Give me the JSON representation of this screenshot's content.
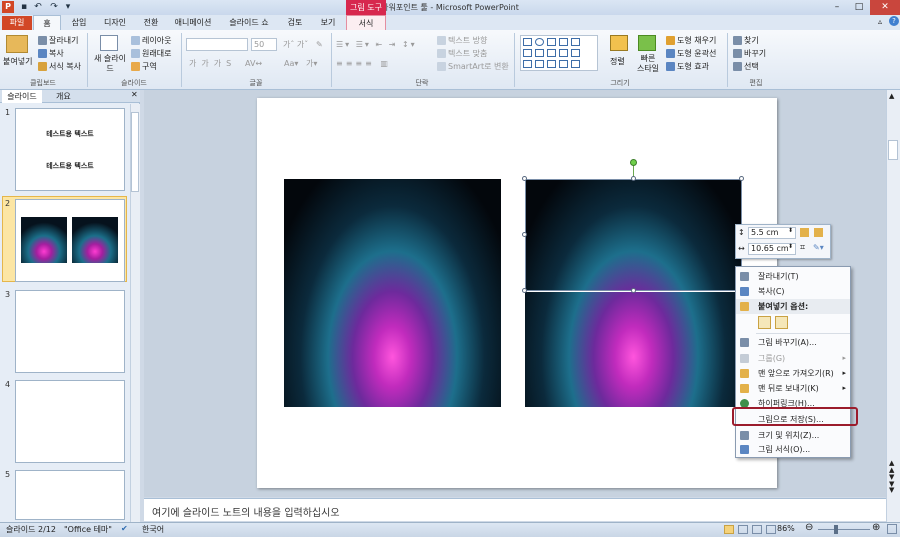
{
  "window": {
    "title": "파워포인트 툴 - Microsoft PowerPoint",
    "contextual_tab": "그림 도구"
  },
  "tabs": [
    "파일",
    "홈",
    "삽입",
    "디자인",
    "전환",
    "애니메이션",
    "슬라이드 쇼",
    "검토",
    "보기",
    "서식"
  ],
  "ribbon": {
    "clipboard": {
      "paste": "붙여넣기",
      "cut": "잘라내기",
      "copy": "복사",
      "format_painter": "서식 복사",
      "label": "클립보드"
    },
    "slides": {
      "new_slide": "새 슬라이드",
      "layout": "레이아웃",
      "reset": "원래대로",
      "section": "구역",
      "label": "슬라이드"
    },
    "font": {
      "size": "50",
      "label": "글꼴"
    },
    "paragraph": {
      "text_direction": "텍스트 방향",
      "align_text": "텍스트 맞춤",
      "smartart": "SmartArt로 변환",
      "label": "단락"
    },
    "drawing": {
      "arrange": "정렬",
      "quick_styles": "빠른 스타일",
      "shape_fill": "도형 채우기",
      "shape_outline": "도형 윤곽선",
      "shape_effects": "도형 효과",
      "label": "그리기"
    },
    "editing": {
      "find": "찾기",
      "replace": "바꾸기",
      "select": "선택",
      "label": "편집"
    }
  },
  "panel": {
    "tab_slides": "슬라이드",
    "tab_outline": "개요",
    "slide1_line1": "테스트용 텍스트",
    "slide1_line2": "테스트용 텍스트",
    "nums": [
      "1",
      "2",
      "3",
      "4",
      "5"
    ]
  },
  "mini_toolbar": {
    "height": "5.5 cm",
    "width": "10.65 cm"
  },
  "context_menu": {
    "cut": "잘라내기(T)",
    "copy": "복사(C)",
    "paste_options": "붙여넣기 옵션:",
    "change_picture": "그림 바꾸기(A)...",
    "group": "그룹(G)",
    "bring_front": "맨 앞으로 가져오기(R)",
    "send_back": "맨 뒤로 보내기(K)",
    "hyperlink": "하이퍼링크(H)...",
    "save_as_picture": "그림으로 저장(S)...",
    "size_position": "크기 및 위치(Z)...",
    "format_picture": "그림 서식(O)..."
  },
  "notes": {
    "placeholder": "여기에 슬라이드 노트의 내용을 입력하십시오"
  },
  "status": {
    "slide": "슬라이드 2/12",
    "theme": "\"Office 테마\"",
    "language": "한국어",
    "zoom": "86%"
  }
}
